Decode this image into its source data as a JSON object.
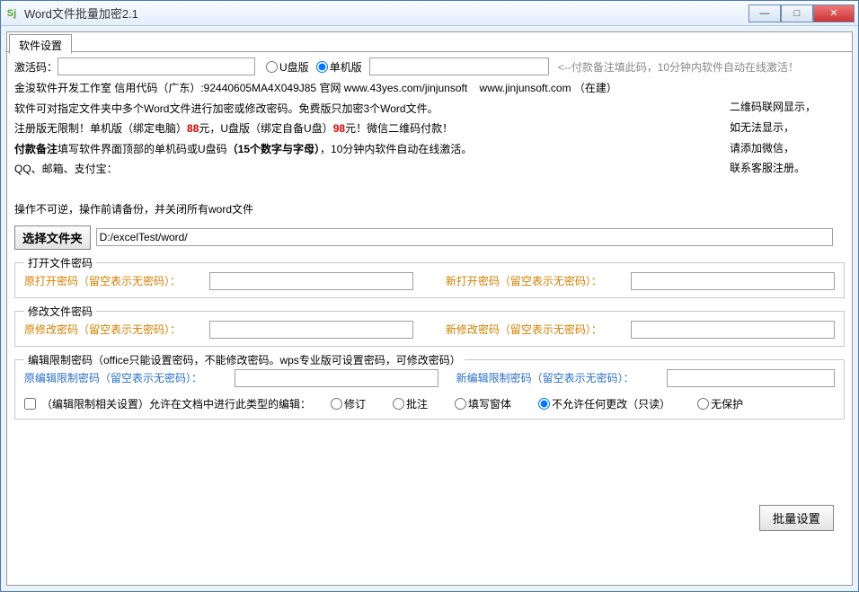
{
  "window": {
    "title": "Word文件批量加密2.1",
    "icon_text": "Sj"
  },
  "win_controls": {
    "min": "—",
    "max": "□",
    "close": "✕"
  },
  "tab": {
    "settings": "软件设置"
  },
  "activation": {
    "label": "激活码：",
    "code_value": "",
    "upan_label": "U盘版",
    "danji_label": "单机版",
    "machine_value": "",
    "hint": "<--付款备注填此码，10分钟内软件自动在线激活！"
  },
  "info": {
    "line1a": "金浚软件开发工作室 信用代码（广东）:92440605MA4X049J85 官网",
    "line1_url1": "www.43yes.com/jinjunsoft",
    "line1_url2": "www.jinjunsoft.com",
    "line1b": "（在建）",
    "line2": "软件可对指定文件夹中多个Word文件进行加密或修改密码。免费版只加密3个Word文件。",
    "line3a": "注册版无限制！单机版（绑定电脑）",
    "price1": "88",
    "line3b": "元，U盘版（绑定自备U盘）",
    "price2": "98",
    "line3c": "元！微信二维码付款！",
    "line4a": "付款备注",
    "line4b": "填写软件界面顶部的单机码或U盘码",
    "line4c": "（15个数字与字母）",
    "line4d": "，10分钟内软件自动在线激活。",
    "line5": "QQ、邮箱、支付宝："
  },
  "right_box": {
    "l1": "二维码联网显示，",
    "l2": "如无法显示，",
    "l3": "请添加微信，",
    "l4": "联系客服注册。"
  },
  "warn": "操作不可逆，操作前请备份，并关闭所有word文件",
  "folder": {
    "btn": "选择文件夹",
    "value": "D:/excelTest/word/"
  },
  "open_pw": {
    "legend": "打开文件密码",
    "old_label": "原打开密码（留空表示无密码）：",
    "new_label": "新打开密码（留空表示无密码）：",
    "old_value": "",
    "new_value": ""
  },
  "modify_pw": {
    "legend": "修改文件密码",
    "old_label": "原修改密码（留空表示无密码）：",
    "new_label": "新修改密码（留空表示无密码）：",
    "old_value": "",
    "new_value": ""
  },
  "restrict": {
    "legend": "编辑限制密码（office只能设置密码，不能修改密码。wps专业版可设置密码，可修改密码）",
    "old_label": "原编辑限制密码（留空表示无密码）：",
    "new_label": "新编辑限制密码（留空表示无密码）：",
    "old_value": "",
    "new_value": "",
    "chk_label": "（编辑限制相关设置）允许在文档中进行此类型的编辑：",
    "opt_rev": "修订",
    "opt_comment": "批注",
    "opt_form": "填写窗体",
    "opt_readonly": "不允许任何更改（只读）",
    "opt_none": "无保护"
  },
  "batch_btn": "批量设置"
}
